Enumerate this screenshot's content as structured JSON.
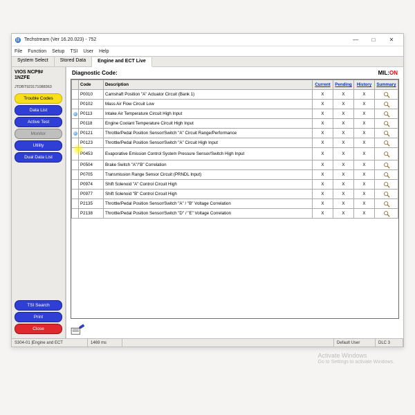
{
  "window": {
    "title": "Techstream (Ver 16.20.023) - 752",
    "min": "—",
    "max": "□",
    "close": "✕"
  },
  "menubar": [
    "File",
    "Function",
    "Setup",
    "TSI",
    "User",
    "Help"
  ],
  "tabs": [
    {
      "label": "System Select",
      "active": false
    },
    {
      "label": "Stored Data",
      "active": false
    },
    {
      "label": "Engine and ECT Live",
      "active": true
    }
  ],
  "vehicle": {
    "line1": "VIOS NCP9#",
    "line2": "1NZFE"
  },
  "vin": "JTDBT923171088363",
  "sidebar_main": [
    {
      "label": "Trouble Codes",
      "style": "yellow"
    },
    {
      "label": "Data List",
      "style": "blue"
    },
    {
      "label": "Active Test",
      "style": "blue"
    },
    {
      "label": "Monitor",
      "style": "gray"
    },
    {
      "label": "Utility",
      "style": "blue"
    },
    {
      "label": "Dual Data List",
      "style": "blue"
    }
  ],
  "sidebar_bottom": [
    {
      "label": "TSI Search",
      "style": "blue"
    },
    {
      "label": "Print",
      "style": "blue"
    },
    {
      "label": "Close",
      "style": "red"
    }
  ],
  "content": {
    "heading": "Diagnostic Code:",
    "mil_label": "MIL:",
    "mil_value": "ON"
  },
  "grid": {
    "headers": {
      "flag": "",
      "code": "Code",
      "desc": "Description",
      "current": "Current",
      "pending": "Pending",
      "history": "History",
      "summary": "Summary"
    },
    "rows": [
      {
        "flag": false,
        "code": "P0010",
        "desc": "Camshaft Position \"A\" Actuator Circuit (Bank 1)",
        "cur": "X",
        "pen": "X",
        "his": "X"
      },
      {
        "flag": false,
        "code": "P0102",
        "desc": "Mass Air Flow Circuit Low",
        "cur": "X",
        "pen": "X",
        "his": "X"
      },
      {
        "flag": true,
        "code": "P0113",
        "desc": "Intake Air Temperature Circuit High Input",
        "cur": "X",
        "pen": "X",
        "his": "X"
      },
      {
        "flag": false,
        "code": "P0118",
        "desc": "Engine Coolant Temperature Circuit High Input",
        "cur": "X",
        "pen": "X",
        "his": "X"
      },
      {
        "flag": true,
        "code": "P0121",
        "desc": "Throttle/Pedal Position Sensor/Switch \"A\" Circuit Range/Performance",
        "cur": "X",
        "pen": "X",
        "his": "X"
      },
      {
        "flag": false,
        "code": "P0123",
        "desc": "Throttle/Pedal Position Sensor/Switch \"A\" Circuit High Input",
        "cur": "X",
        "pen": "X",
        "his": "X"
      },
      {
        "flag": false,
        "code": "P0453",
        "desc": "Evaporative Emission Control System Pressure Sensor/Switch High Input",
        "cur": "X",
        "pen": "X",
        "his": "X",
        "tall": true
      },
      {
        "flag": false,
        "code": "P0504",
        "desc": "Brake Switch \"A\"/\"B\" Correlation",
        "cur": "X",
        "pen": "X",
        "his": "X"
      },
      {
        "flag": false,
        "code": "P0705",
        "desc": "Transmission Range Sensor Circuit (PRNDL Input)",
        "cur": "X",
        "pen": "X",
        "his": "X"
      },
      {
        "flag": false,
        "code": "P0974",
        "desc": "Shift Solenoid \"A\" Control Circuit High",
        "cur": "X",
        "pen": "X",
        "his": "X"
      },
      {
        "flag": false,
        "code": "P0977",
        "desc": "Shift Solenoid \"B\" Control Circuit High",
        "cur": "X",
        "pen": "X",
        "his": "X"
      },
      {
        "flag": false,
        "code": "P2135",
        "desc": "Throttle/Pedal Position Sensor/Switch \"A\" / \"B\" Voltage Correlation",
        "cur": "X",
        "pen": "X",
        "his": "X"
      },
      {
        "flag": false,
        "code": "P2138",
        "desc": "Throttle/Pedal Position Sensor/Switch \"D\" / \"E\" Voltage Correlation",
        "cur": "X",
        "pen": "X",
        "his": "X"
      }
    ]
  },
  "statusbar": {
    "left": "S304-01  |Engine and ECT",
    "ms": "1469 ms",
    "user": "Default User",
    "dlc": "DLC 3"
  },
  "watermark": {
    "line1": "Activate Windows",
    "line2": "Go to Settings to activate Windows."
  }
}
